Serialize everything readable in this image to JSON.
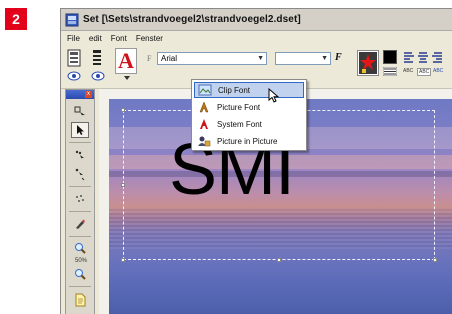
{
  "step": {
    "number": "2"
  },
  "window": {
    "title": "Set [\\Sets\\strandvoegel2\\strandvoegel2.dset]",
    "menu": [
      "File",
      "edit",
      "Font",
      "Fenster"
    ]
  },
  "toolbar": {
    "font_name": "Arial",
    "size_value": "",
    "font_icon_letter": "A",
    "font_prefix_icon": "F",
    "style_icon_letter": "F",
    "tiny_label_1": "ABC",
    "tiny_label_2": "ABC",
    "tiny_label_3": "ABC"
  },
  "left_panel": {
    "close_glyph": "x",
    "zoom_label": "50%"
  },
  "font_menu": {
    "items": [
      {
        "label": "Clip Font",
        "icon": "clip-font-icon",
        "highlighted": true
      },
      {
        "label": "Picture Font",
        "icon": "picture-font-icon",
        "highlighted": false
      },
      {
        "label": "System Font",
        "icon": "system-font-icon",
        "highlighted": false
      },
      {
        "label": "Picture in Picture",
        "icon": "picture-in-picture-icon",
        "highlighted": false
      }
    ]
  },
  "canvas": {
    "text": "SMI"
  },
  "colors": {
    "badge": "#e3001b",
    "menu_highlight": "#c1d2ee",
    "text_fill": "#000000"
  }
}
